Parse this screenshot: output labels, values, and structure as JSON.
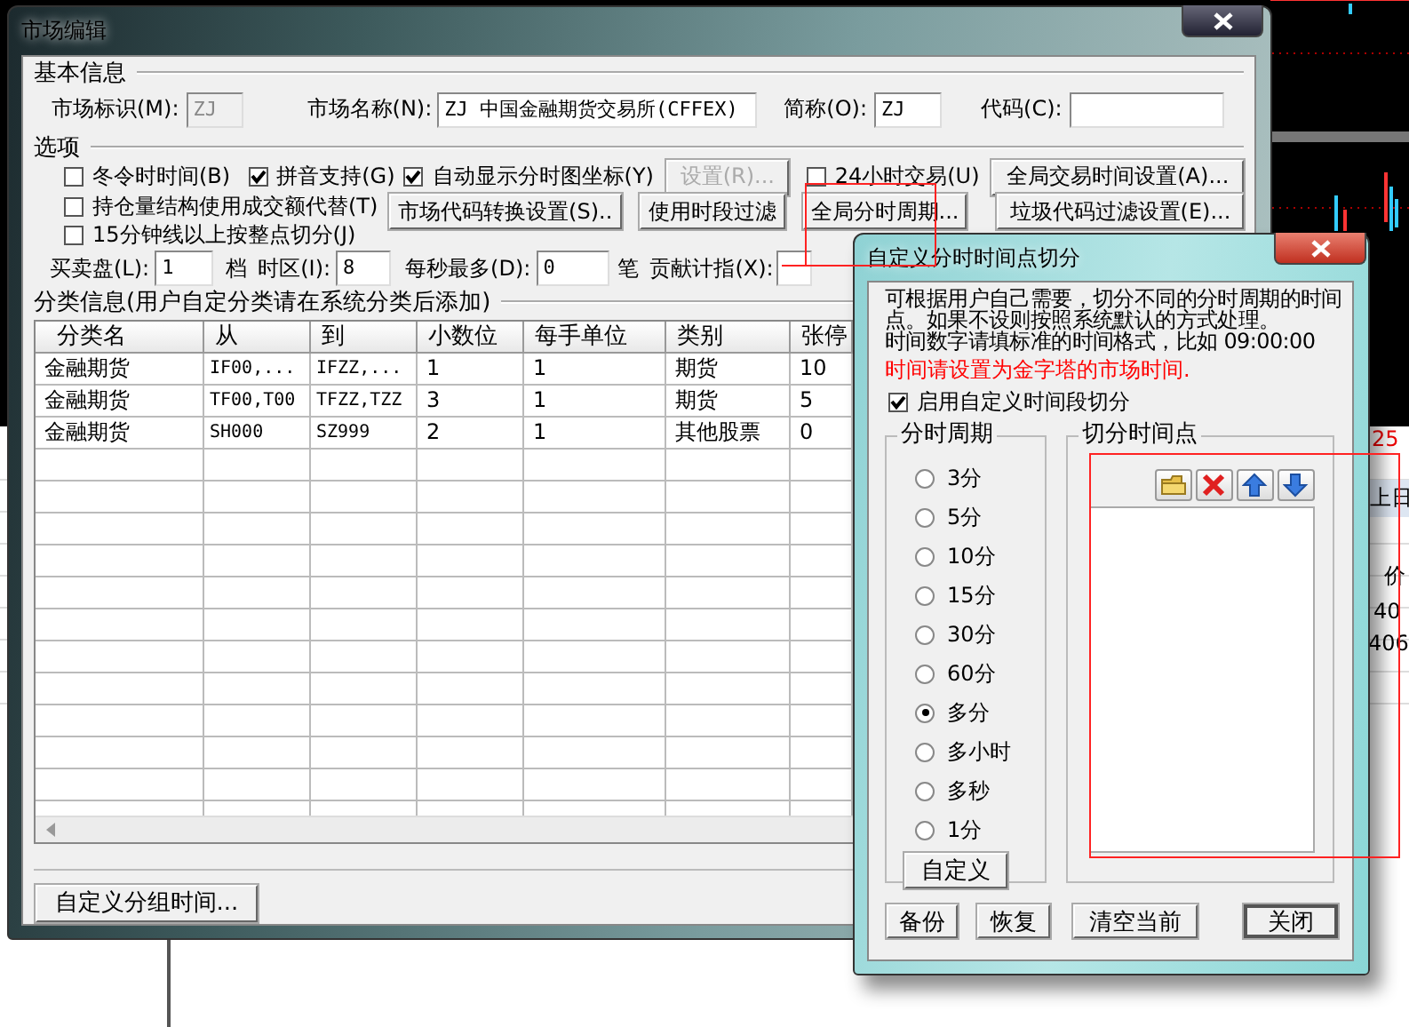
{
  "main_window": {
    "title": "市场编辑",
    "basic_info": {
      "label": "基本信息",
      "fields": [
        {
          "label": "市场标识(M):",
          "value": "ZJ",
          "disabled": true
        },
        {
          "label": "市场名称(N):",
          "value": "ZJ 中国金融期货交易所(CFFEX)",
          "disabled": false
        },
        {
          "label": "简称(O):",
          "value": "ZJ",
          "disabled": false
        },
        {
          "label": "代码(C):",
          "disabled": false
        }
      ]
    },
    "options": {
      "label": "选项",
      "checkboxes": [
        {
          "label": "冬令时时间(B)",
          "checked": false
        },
        {
          "label": "拼音支持(G)",
          "checked": true
        },
        {
          "label": "自动显示分时图坐标(Y)",
          "checked": true
        },
        {
          "label": "24小时交易(U)",
          "checked": false
        },
        {
          "label": "持仓量结构使用成交额代替(T)",
          "checked": false
        },
        {
          "label": "15分钟线以上按整点切分(J)",
          "checked": false
        }
      ],
      "buttons": [
        {
          "label": "设置(R)...",
          "disabled": true
        },
        {
          "label": "全局交易时间设置(A)...",
          "disabled": false
        },
        {
          "label": "市场代码转换设置(S)..",
          "disabled": false
        },
        {
          "label": "使用时段过滤",
          "disabled": false
        },
        {
          "label": "全局分时周期...",
          "disabled": false
        },
        {
          "label": "垃圾代码过滤设置(E)...",
          "disabled": false
        }
      ]
    },
    "limits": [
      {
        "kind": "label",
        "text": "买卖盘(L):"
      },
      {
        "kind": "field",
        "value": "1"
      },
      {
        "kind": "label",
        "text": "档"
      },
      {
        "kind": "label",
        "text": "时区(I):"
      },
      {
        "kind": "field",
        "value": "8"
      },
      {
        "kind": "label",
        "text": "每秒最多(D):"
      },
      {
        "kind": "field",
        "value": "0"
      },
      {
        "kind": "label",
        "text": "笔"
      },
      {
        "kind": "label",
        "text": "贡献计指(X):"
      },
      {
        "kind": "field"
      }
    ],
    "categories": {
      "label": "分类信息(用户自定分类请在系统分类后添加)",
      "columns": [
        "分类名",
        "从",
        "到",
        "小数位",
        "每手单位",
        "类别",
        "张停"
      ],
      "rows": [
        [
          "金融期货",
          "IF00,...",
          "IFZZ,...",
          "1",
          "1",
          "期货",
          "10"
        ],
        [
          "金融期货",
          "TF00,T00",
          "TFZZ,TZZ",
          "3",
          "1",
          "期货",
          "5"
        ],
        [
          "金融期货",
          "SH000",
          "SZ999",
          "2",
          "1",
          "其他股票",
          "0"
        ]
      ]
    },
    "buttons": [
      "自定义分组时间..."
    ]
  },
  "time_split_dialog": {
    "title": "自定义分时时间点切分",
    "description": [
      "可根据用户自己需要，切分不同的分时周期的时间点。如果不设则按照系统默认的方式处理。",
      "时间数字请填标准的时间格式，比如 09:00:00"
    ],
    "warning": "时间请设置为金字塔的市场时间.",
    "enable": {
      "label": "启用自定义时间段切分",
      "checked": true
    },
    "period_group": {
      "label": "分时周期",
      "options": [
        {
          "label": "3分",
          "selected": false
        },
        {
          "label": "5分",
          "selected": false
        },
        {
          "label": "10分",
          "selected": false
        },
        {
          "label": "15分",
          "selected": false
        },
        {
          "label": "30分",
          "selected": false
        },
        {
          "label": "60分",
          "selected": false
        },
        {
          "label": "多分",
          "selected": true
        },
        {
          "label": "多小时",
          "selected": false
        },
        {
          "label": "多秒",
          "selected": false
        },
        {
          "label": "1分",
          "selected": false
        }
      ],
      "button": "自定义"
    },
    "split_group": {
      "label": "切分时间点",
      "tools": [
        {
          "kind": "folder"
        },
        {
          "kind": "delete"
        },
        {
          "kind": "up"
        },
        {
          "kind": "down"
        }
      ]
    },
    "buttons": [
      "备份",
      "恢复",
      "清空当前",
      "关闭"
    ]
  },
  "background": {
    "fragments": [
      {
        "text": "25",
        "kind": "red"
      },
      {
        "text": "上日",
        "kind": "header"
      },
      {
        "text": "价",
        "kind": "plain"
      },
      {
        "text": "40",
        "kind": "plain"
      },
      {
        "text": "406",
        "kind": "plain"
      }
    ]
  }
}
